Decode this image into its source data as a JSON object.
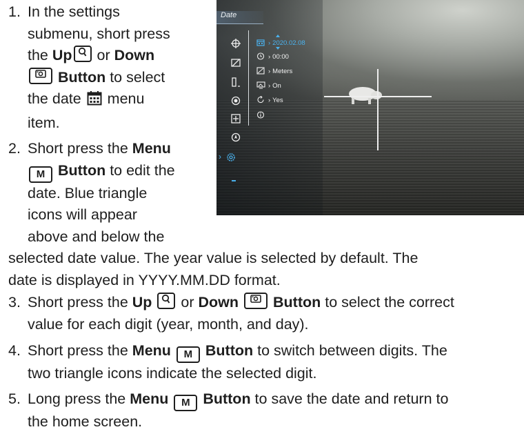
{
  "device_screen": {
    "title": "Date",
    "menu_rows": [
      {
        "icon": "calendar-icon",
        "value": "2020.02.08",
        "selected": true
      },
      {
        "icon": "clock-icon",
        "value": "00:00",
        "selected": false
      },
      {
        "icon": "ruler-icon",
        "value": "Meters",
        "selected": false
      },
      {
        "icon": "screen-icon",
        "value": "On",
        "selected": false
      },
      {
        "icon": "restore-icon",
        "value": "Yes",
        "selected": false
      },
      {
        "icon": "info-icon",
        "value": "",
        "selected": false
      }
    ],
    "sidebar_icons": [
      "crosshair-icon",
      "calibration-icon",
      "zoom-icon",
      "target-icon",
      "add-icon",
      "compass-icon",
      "settings-icon"
    ],
    "accent_color": "#4ab2ee"
  },
  "steps": [
    {
      "num": "1.",
      "lines": [
        [
          "In the settings"
        ],
        [
          "submenu, short press"
        ],
        [
          "the ",
          {
            "b": "Up"
          },
          {
            "key": "up"
          },
          " or ",
          {
            "b": "Down"
          }
        ],
        [
          {
            "key": "down"
          },
          {
            "b": " Button"
          },
          " to select"
        ],
        [
          "the date ",
          {
            "icon": "calendar"
          },
          " menu"
        ],
        [
          "item."
        ]
      ]
    },
    {
      "num": "2.",
      "lines": [
        [
          "Short press the ",
          {
            "b": "Menu"
          }
        ],
        [
          {
            "key": "menu"
          },
          {
            "b": " Button"
          },
          " to edit the"
        ],
        [
          "date. Blue triangle"
        ],
        [
          "icons will appear"
        ],
        [
          "above and below the"
        ],
        [
          "selected date value. The year value is selected by default. The"
        ],
        [
          "date is displayed in YYYY.MM.DD format."
        ]
      ]
    },
    {
      "num": "3.",
      "lines": [
        [
          "Short press the ",
          {
            "b": "Up"
          },
          " ",
          {
            "key": "up"
          },
          " or ",
          {
            "b": "Down"
          },
          " ",
          {
            "key": "down"
          },
          " ",
          {
            "b": "Button"
          },
          " to select the correct"
        ],
        [
          "value for each digit (year, month, and day)."
        ]
      ]
    },
    {
      "num": "4.",
      "lines": [
        [
          "Short press the ",
          {
            "b": "Menu"
          },
          " ",
          {
            "key": "menu"
          },
          " ",
          {
            "b": "Button"
          },
          " to switch between digits. The"
        ],
        [
          "two triangle icons indicate the selected digit."
        ]
      ]
    },
    {
      "num": "5.",
      "lines": [
        [
          "Long press the ",
          {
            "b": "Menu"
          },
          " ",
          {
            "key": "menu"
          },
          " ",
          {
            "b": "Button"
          },
          " to save the date and return to"
        ],
        [
          "the home screen."
        ]
      ]
    }
  ],
  "key_labels": {
    "menu": "M"
  }
}
